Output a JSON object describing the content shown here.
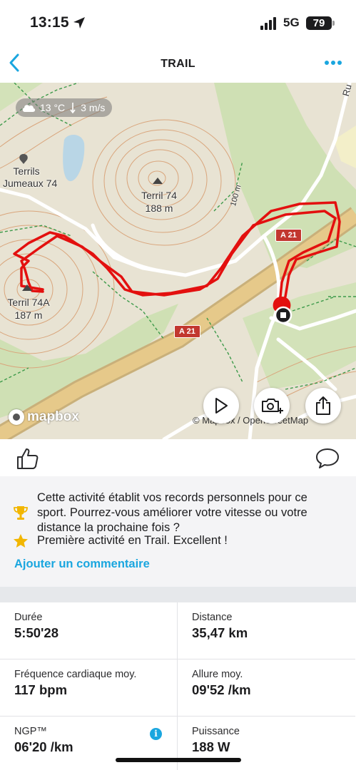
{
  "status_bar": {
    "time": "13:15",
    "network": "5G",
    "battery": "79"
  },
  "nav": {
    "title": "TRAIL"
  },
  "map": {
    "weather": {
      "temperature": "13 °C",
      "wind": "3 m/s"
    },
    "labels": {
      "terrils_jumeaux": "Terrils\nJumeaux 74",
      "terril_74": "Terril 74",
      "terril_74_alt": "188 m",
      "terril_74a": "Terril 74A",
      "terril_74a_alt": "187 m",
      "contour_100": "100 m",
      "road_a21_upper": "A 21",
      "road_a21_lower": "A 21",
      "road_edge": "Ru"
    },
    "attribution": "© Mapbox / OpenStreetMap",
    "logo_text": "mapbox",
    "route_color": "#e3100f",
    "buttons": [
      "play-icon",
      "add-photo-icon",
      "share-icon"
    ]
  },
  "records": {
    "items": [
      {
        "icon": "trophy-icon",
        "text": "Cette activité établit vos records personnels pour ce sport. Pourrez-vous améliorer votre vitesse ou votre distance la prochaine fois ?"
      },
      {
        "icon": "star-icon",
        "text": "Première activité en Trail. Excellent !"
      }
    ],
    "add_comment": "Ajouter un commentaire"
  },
  "stats": [
    {
      "label": "Durée",
      "value": "5:50'28"
    },
    {
      "label": "Distance",
      "value": "35,47 km"
    },
    {
      "label": "Fréquence cardiaque moy.",
      "value": "117 bpm"
    },
    {
      "label": "Allure moy.",
      "value": "09'52 /km"
    },
    {
      "label": "NGP™",
      "value": "06'20 /km",
      "info": "i"
    },
    {
      "label": "Puissance",
      "value": "188 W"
    }
  ],
  "colors": {
    "accent": "#1aa6df",
    "route": "#e3100f",
    "trophy": "#f2b600",
    "star": "#f2b600"
  }
}
